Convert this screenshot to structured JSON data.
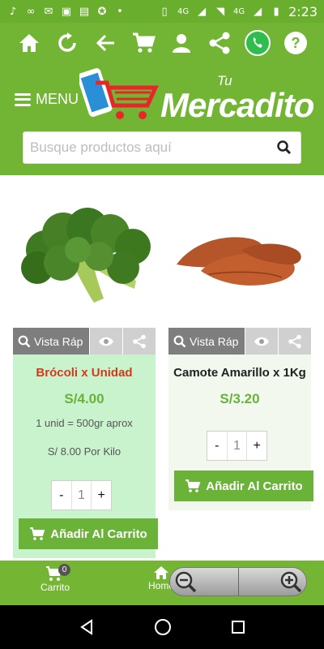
{
  "status_bar": {
    "time": "2:23",
    "network": "4G",
    "network_small": "4G"
  },
  "header": {
    "menu_label": "MENU",
    "logo_small": "Tu",
    "logo_main": "Mercadito",
    "search_placeholder": "Busque productos aquí"
  },
  "products": [
    {
      "name": "Brócoli x Unidad",
      "price": "S/4.00",
      "note": "1 unid = 500gr aprox",
      "per_kilo": "S/ 8.00 Por Kilo",
      "quick_view": "Vista Ráp",
      "qty_minus": "-",
      "qty_value": "1",
      "qty_plus": "+",
      "add_label": "Añadir Al Carrito"
    },
    {
      "name": "Camote Amarillo x 1Kg",
      "price": "S/3.20",
      "quick_view": "Vista Ráp",
      "qty_minus": "-",
      "qty_value": "1",
      "qty_plus": "+",
      "add_label": "Añadir Al Carrito"
    }
  ],
  "bottom_nav": {
    "cart_label": "Carrito",
    "cart_count": "0",
    "home_label": "Home"
  },
  "colors": {
    "brand_green": "#72b433",
    "price_green": "#69b23a",
    "title_red": "#d23a1b"
  }
}
